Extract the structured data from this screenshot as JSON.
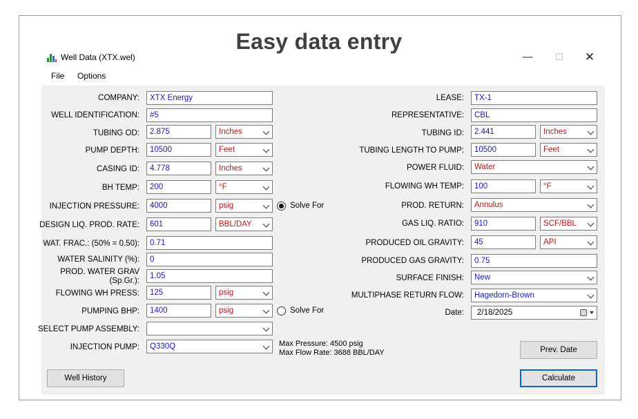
{
  "banner": "Easy data entry",
  "window": {
    "title": "Well Data (XTX.wel)",
    "icon": "bar-chart-icon",
    "minimize_glyph": "—",
    "maximize_glyph": "☐",
    "close_glyph": "✕"
  },
  "menu": {
    "file": "File",
    "options": "Options"
  },
  "left": {
    "company": {
      "label": "COMPANY:",
      "value": "XTX Energy"
    },
    "well_identification": {
      "label": "WELL IDENTIFICATION:",
      "value": "#5"
    },
    "tubing_od": {
      "label": "TUBING OD:",
      "value": "2.875",
      "unit": "Inches"
    },
    "pump_depth": {
      "label": "PUMP DEPTH:",
      "value": "10500",
      "unit": "Feet"
    },
    "casing_id": {
      "label": "CASING ID:",
      "value": "4.778",
      "unit": "Inches"
    },
    "bh_temp": {
      "label": "BH TEMP:",
      "value": "200",
      "unit": "°F"
    },
    "injection_pressure": {
      "label": "INJECTION PRESSURE:",
      "value": "4000",
      "unit": "psig",
      "solve_for": "Solve For",
      "solve_for_checked": true
    },
    "design_liq_prod_rate": {
      "label": "DESIGN LIQ. PROD. RATE:",
      "value": "601",
      "unit": "BBL/DAY"
    },
    "wat_frac": {
      "label": "WAT. FRAC.: (50% = 0.50):",
      "value": "0.71"
    },
    "water_salinity": {
      "label": "WATER SALINITY (%):",
      "value": "0"
    },
    "prod_water_grav": {
      "label_line1": "PROD. WATER GRAV",
      "label_line2": "(Sp.Gr.):",
      "value": "1.05"
    },
    "flowing_wh_press": {
      "label": "FLOWING WH PRESS:",
      "value": "125",
      "unit": "psig"
    },
    "pumping_bhp": {
      "label": "PUMPING BHP:",
      "value": "1400",
      "unit": "psig",
      "solve_for": "Solve For",
      "solve_for_checked": false
    },
    "select_pump_assembly": {
      "label": "SELECT PUMP ASSEMBLY:",
      "value": ""
    },
    "injection_pump": {
      "label": "INJECTION PUMP:",
      "value": "Q330Q"
    },
    "pump_info": {
      "line1": "Max Pressure: 4500 psig",
      "line2": "Max Flow Rate: 3688 BBL/DAY"
    }
  },
  "right": {
    "lease": {
      "label": "LEASE:",
      "value": "TX-1"
    },
    "representative": {
      "label": "REPRESENTATIVE:",
      "value": "CBL"
    },
    "tubing_id": {
      "label": "TUBING ID:",
      "value": "2.441",
      "unit": "Inches"
    },
    "tubing_length_to_pump": {
      "label": "TUBING LENGTH TO PUMP:",
      "value": "10500",
      "unit": "Feet"
    },
    "power_fluid": {
      "label": "POWER FLUID:",
      "value": "Water"
    },
    "flowing_wh_temp": {
      "label": "FLOWING WH TEMP:",
      "value": "100",
      "unit": "°F"
    },
    "prod_return": {
      "label": "PROD. RETURN:",
      "value": "Annulus"
    },
    "gas_liq_ratio": {
      "label": "GAS LIQ. RATIO:",
      "value": "910",
      "unit": "SCF/BBL"
    },
    "produced_oil_gravity": {
      "label": "PRODUCED OIL GRAVITY:",
      "value": "45",
      "unit": "API"
    },
    "produced_gas_gravity": {
      "label": "PRODUCED GAS GRAVITY:",
      "value": "0.75"
    },
    "surface_finish": {
      "label": "SURFACE FINISH:",
      "value": "New"
    },
    "multiphase_return_flow": {
      "label": "MULTIPHASE RETURN FLOW:",
      "value": "Hagedorn-Brown"
    },
    "date": {
      "label": "Date:",
      "value": "2/18/2025"
    }
  },
  "buttons": {
    "well_history": "Well History",
    "prev_date": "Prev. Date",
    "calculate": "Calculate"
  }
}
